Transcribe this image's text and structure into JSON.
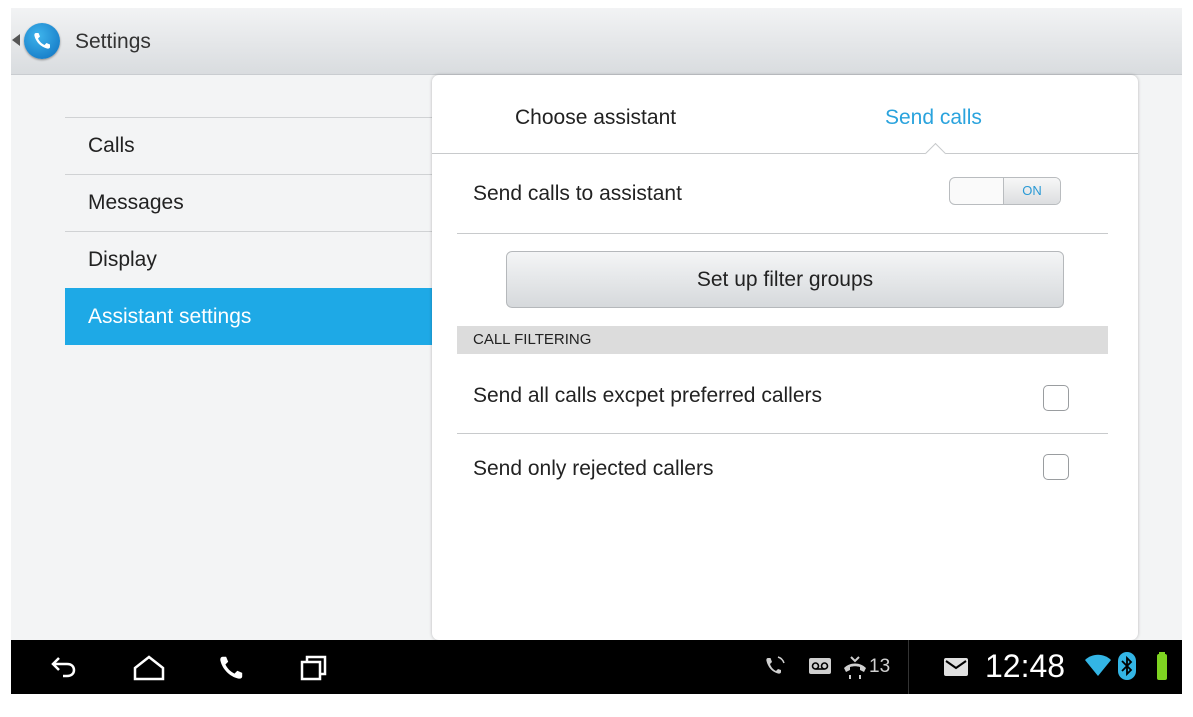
{
  "action_bar": {
    "title": "Settings",
    "app_icon": "phone-icon",
    "back_icon": "back-caret-icon"
  },
  "menu": {
    "items": [
      {
        "label": "Calls",
        "active": false
      },
      {
        "label": "Messages",
        "active": false
      },
      {
        "label": "Display",
        "active": false
      },
      {
        "label": "Assistant settings",
        "active": true
      }
    ]
  },
  "panel": {
    "tabs": [
      {
        "label": "Choose assistant",
        "selected": false
      },
      {
        "label": "Send calls",
        "selected": true
      }
    ],
    "send_calls_label": "Send calls to assistant",
    "toggle_state": "ON",
    "filter_button": "Set up filter groups",
    "section_header": "CALL FILTERING",
    "options": [
      {
        "label": "Send all calls excpet preferred callers",
        "checked": false
      },
      {
        "label": "Send only rejected callers",
        "checked": false
      }
    ]
  },
  "nav_bar": {
    "icons": [
      "back-icon",
      "home-icon",
      "phone-icon",
      "recent-apps-icon"
    ],
    "status_icons": [
      "call-forward-icon",
      "voicemail-icon",
      "missed-calls-icon",
      "mail-icon",
      "wifi-icon",
      "bluetooth-icon",
      "battery-icon"
    ],
    "notification_count": "13",
    "time": "12:48"
  },
  "colors": {
    "accent": "#1ea9e6",
    "tab_selected": "#2aa3dd",
    "battery": "#7ed321"
  }
}
